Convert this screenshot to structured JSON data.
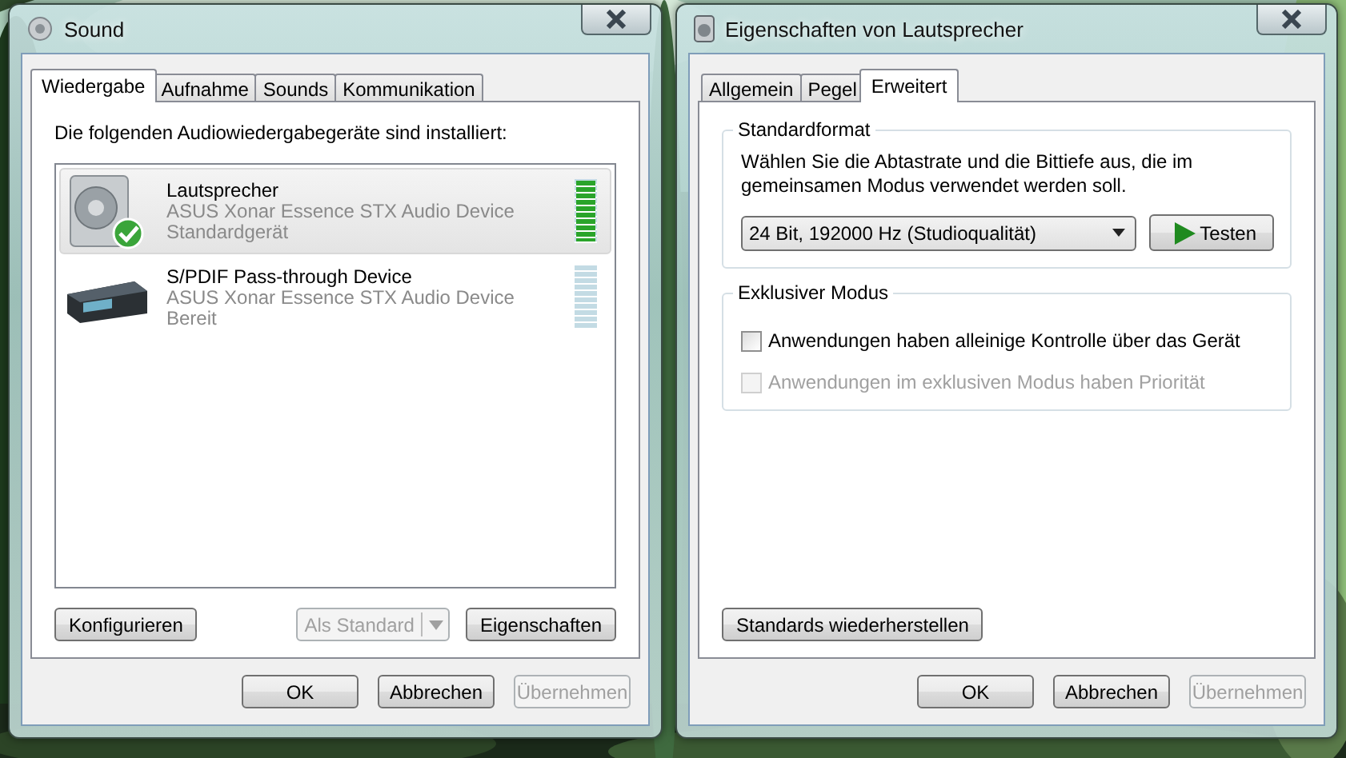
{
  "sound_window": {
    "title": "Sound",
    "tabs": [
      {
        "label": "Wiedergabe",
        "selected": true
      },
      {
        "label": "Aufnahme",
        "selected": false
      },
      {
        "label": "Sounds",
        "selected": false
      },
      {
        "label": "Kommunikation",
        "selected": false
      }
    ],
    "intro": "Die folgenden Audiowiedergabegeräte sind installiert:",
    "devices": [
      {
        "kind": "speaker",
        "name": "Lautsprecher",
        "driver": "ASUS Xonar Essence STX Audio Device",
        "status": "Standardgerät",
        "default": true,
        "selected": true,
        "level": 1
      },
      {
        "kind": "receiver",
        "name": "S/PDIF Pass-through Device",
        "driver": "ASUS Xonar Essence STX Audio Device",
        "status": "Bereit",
        "default": false,
        "selected": false,
        "level": 0
      }
    ],
    "configure_button": {
      "label": "Konfigurieren",
      "disabled": false
    },
    "default_button": {
      "label": "Als Standard",
      "disabled": true
    },
    "properties_button": {
      "label": "Eigenschaften",
      "disabled": false
    },
    "footer_buttons": [
      {
        "label": "OK",
        "disabled": false
      },
      {
        "label": "Abbrechen",
        "disabled": false
      },
      {
        "label": "Übernehmen",
        "disabled": true
      }
    ]
  },
  "properties_window": {
    "title": "Eigenschaften von Lautsprecher",
    "tabs": [
      {
        "label": "Allgemein",
        "selected": false
      },
      {
        "label": "Pegel",
        "selected": false
      },
      {
        "label": "Erweitert",
        "selected": true
      }
    ],
    "standard_format": {
      "legend": "Standardformat",
      "description": "Wählen Sie die Abtastrate und die Bittiefe aus, die im gemeinsamen Modus verwendet werden soll.",
      "format": "24 Bit, 192000 Hz (Studioqualität)",
      "test_button": "Testen"
    },
    "exclusive_mode": {
      "legend": "Exklusiver Modus",
      "options": [
        {
          "label": "Anwendungen haben alleinige Kontrolle über das Gerät",
          "checked": false,
          "disabled": false
        },
        {
          "label": "Anwendungen im exklusiven Modus haben Priorität",
          "checked": false,
          "disabled": true
        }
      ]
    },
    "restore_button": {
      "label": "Standards wiederherstellen",
      "disabled": false
    },
    "footer_buttons": [
      {
        "label": "OK",
        "disabled": false
      },
      {
        "label": "Abbrechen",
        "disabled": false
      },
      {
        "label": "Übernehmen",
        "disabled": true
      }
    ]
  }
}
